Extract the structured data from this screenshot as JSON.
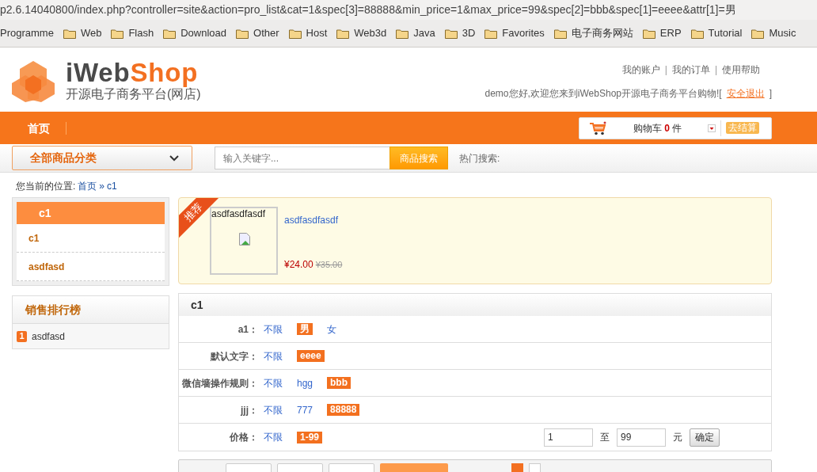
{
  "address_bar": {
    "url": "p2.6.14040800/index.php?controller=site&action=pro_list&cat=1&spec[3]=88888&min_price=1&max_price=99&spec[2]=bbb&spec[1]=eeee&attr[1]=男"
  },
  "bookmarks": [
    {
      "label": "Programme",
      "kind": "text"
    },
    {
      "label": "Web",
      "kind": "folder"
    },
    {
      "label": "Flash",
      "kind": "folder"
    },
    {
      "label": "Download",
      "kind": "folder"
    },
    {
      "label": "Other",
      "kind": "folder"
    },
    {
      "label": "Host",
      "kind": "folder"
    },
    {
      "label": "Web3d",
      "kind": "folder"
    },
    {
      "label": "Java",
      "kind": "folder"
    },
    {
      "label": "3D",
      "kind": "folder"
    },
    {
      "label": "Favorites",
      "kind": "folder"
    },
    {
      "label": "电子商务网站",
      "kind": "folder"
    },
    {
      "label": "ERP",
      "kind": "folder"
    },
    {
      "label": "Tutorial",
      "kind": "folder"
    },
    {
      "label": "Music",
      "kind": "folder"
    }
  ],
  "header": {
    "logo": {
      "part_a": "iWeb",
      "part_b": "Shop",
      "tagline": "开源电子商务平台(网店)"
    },
    "top_links": [
      "我的账户",
      "我的订单",
      "使用帮助"
    ],
    "link_separator": "|",
    "welcome": "demo您好,欢迎您来到iWebShop开源电子商务平台购物![",
    "logout": "安全退出",
    "welcome_end": "]"
  },
  "nav": [
    {
      "label": "首页",
      "selected": true
    }
  ],
  "cart": {
    "label": "购物车",
    "count": "0",
    "unit": "件",
    "checkout": "去结算"
  },
  "search_bar": {
    "category_button": "全部商品分类",
    "placeholder": "输入关键字...",
    "search_button": "商品搜索",
    "hot_label": "热门搜索:"
  },
  "breadcrumb": {
    "prefix": "您当前的位置:",
    "links": [
      "首页",
      "c1"
    ],
    "separator": "»"
  },
  "category_box": {
    "title": "c1",
    "items": [
      "c1",
      "asdfasd"
    ]
  },
  "sales_rank": {
    "title": "销售排行榜",
    "items": [
      {
        "rank": "1",
        "name": "asdfasd"
      }
    ]
  },
  "featured": {
    "ribbon": "推荐",
    "image_alt": "asdfasdfasdf",
    "name": "asdfasdfasdf",
    "price": "¥24.00",
    "old_price": "¥35.00"
  },
  "filter": {
    "title": "c1",
    "rows": [
      {
        "kind": "options",
        "label": "a1：",
        "options": [
          {
            "text": "不限",
            "selected": false
          },
          {
            "text": "男",
            "selected": true
          },
          {
            "text": "女",
            "selected": false
          }
        ]
      },
      {
        "kind": "options",
        "label": "默认文字：",
        "options": [
          {
            "text": "不限",
            "selected": false
          },
          {
            "text": "eeee",
            "selected": true
          }
        ]
      },
      {
        "kind": "options",
        "label": "微信墙操作规则：",
        "options": [
          {
            "text": "不限",
            "selected": false
          },
          {
            "text": "hgg",
            "selected": false
          },
          {
            "text": "bbb",
            "selected": true
          }
        ]
      },
      {
        "kind": "options",
        "label": "jjj：",
        "options": [
          {
            "text": "不限",
            "selected": false
          },
          {
            "text": "777",
            "selected": false
          },
          {
            "text": "88888",
            "selected": true
          }
        ]
      },
      {
        "kind": "price",
        "label": "价格：",
        "options": [
          {
            "text": "不限",
            "selected": false
          },
          {
            "text": "1-99",
            "selected": true
          }
        ],
        "min": "1",
        "to_label": "至",
        "max": "99",
        "unit": "元",
        "confirm": "确定"
      }
    ]
  }
}
